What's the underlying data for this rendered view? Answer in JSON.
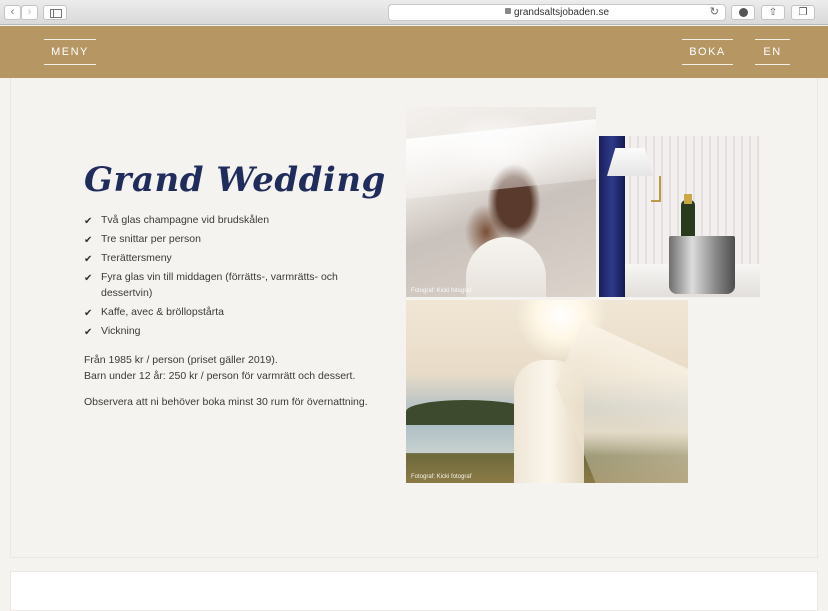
{
  "browser": {
    "url": "grandsaltsjobaden.se",
    "back_icon": "chevron-left-icon",
    "forward_icon": "chevron-right-icon"
  },
  "header": {
    "menu_label": "MENY",
    "book_label": "BOKA",
    "lang_label": "EN",
    "background_color": "#b69764"
  },
  "package": {
    "title": "Grand Wedding",
    "title_color": "#1f2c5c",
    "features": [
      "Två glas champagne vid brudskålen",
      "Tre snittar per person",
      "Trerättersmeny",
      "Fyra glas vin till middagen (förrätts-, varmrätts- och dessertvin)",
      "Kaffe, avec & bröllopstårta",
      "Vickning"
    ],
    "price_line_1": "Från 1985 kr / person (priset gäller 2019).",
    "price_line_2": "Barn under 12 år: 250 kr / person för varmrätt och dessert.",
    "note": "Observera att ni behöver boka minst 30 rum för övernattning."
  },
  "photos": {
    "credit_1": "Fotograf: Kicki fotograf",
    "credit_2": "Fotograf: Kicki fotograf"
  }
}
